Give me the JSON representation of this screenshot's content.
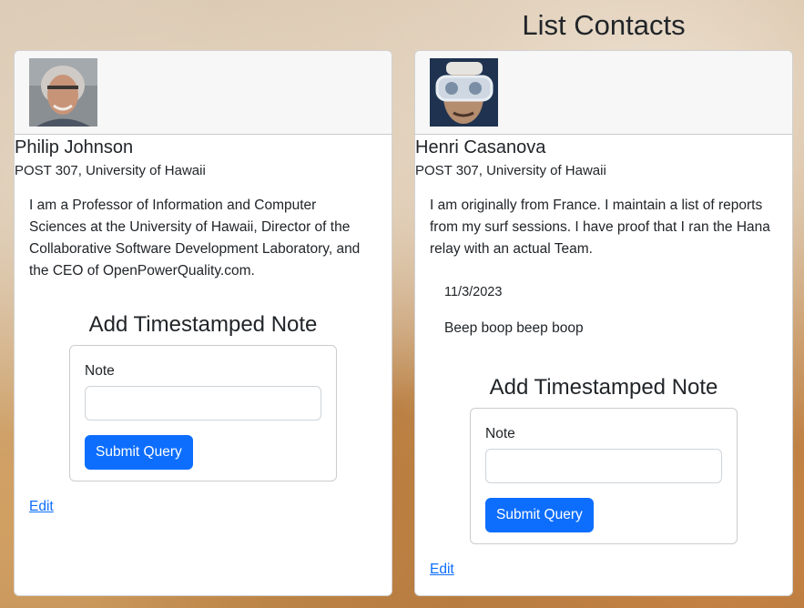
{
  "page": {
    "title": "List Contacts"
  },
  "contacts": [
    {
      "name": "Philip Johnson",
      "address": "POST 307, University of Hawaii",
      "description": "I am a Professor of Information and Computer Sciences at the University of Hawaii, Director of the Collaborative Software Development Laboratory, and the CEO of OpenPowerQuality.com.",
      "notes": [],
      "form": {
        "title": "Add Timestamped Note",
        "label": "Note",
        "value": "",
        "submit": "Submit Query"
      },
      "edit": "Edit"
    },
    {
      "name": "Henri Casanova",
      "address": "POST 307, University of Hawaii",
      "description": "I am originally from France. I maintain a list of reports from my surf sessions. I have proof that I ran the Hana relay with an actual Team.",
      "notes": [
        {
          "date": "11/3/2023",
          "text": "Beep boop beep boop"
        }
      ],
      "form": {
        "title": "Add Timestamped Note",
        "label": "Note",
        "value": "",
        "submit": "Submit Query"
      },
      "edit": "Edit"
    }
  ]
}
